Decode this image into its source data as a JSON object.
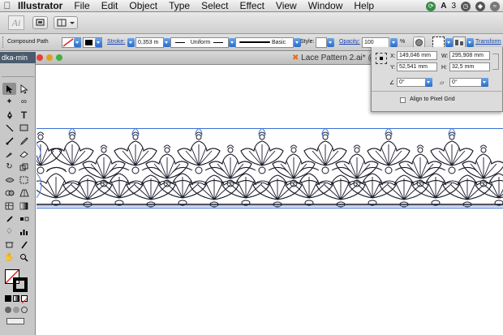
{
  "menubar": {
    "app_name": "Illustrator",
    "items": [
      "File",
      "Edit",
      "Object",
      "Type",
      "Select",
      "Effect",
      "View",
      "Window",
      "Help"
    ],
    "status_number": "3"
  },
  "appbar": {
    "logo_text": "Ai"
  },
  "control_bar": {
    "object_type": "Compound Path",
    "stroke_label": "Stroke:",
    "stroke_weight": "0,353 m",
    "profile": "Uniform",
    "brush": "Basic",
    "style_label": "Style:",
    "opacity_label": "Opacity:",
    "opacity_value": "100",
    "percent": "%",
    "transform_label": "Transform"
  },
  "left_panel": {
    "title": "dka-min"
  },
  "document": {
    "tab_title": "Lace Pattern 2.ai* @"
  },
  "transform_panel": {
    "x_label": "X:",
    "x_value": "149,046 mm",
    "y_label": "Y:",
    "y_value": "52,541 mm",
    "w_label": "W:",
    "w_value": "295,908 mm",
    "h_label": "H:",
    "h_value": "32,5 mm",
    "rotate_value": "0°",
    "shear_value": "0°",
    "pixel_grid_label": "Align to Pixel Grid"
  },
  "colors": {
    "selection": "#3b6fd4",
    "artwork": "#1a1a2a",
    "accent": "#2a6cc9",
    "panel_title": "#4b5a6d"
  },
  "icons": [
    "apple-icon",
    "selection-tool-icon",
    "direct-selection-icon",
    "pen-icon",
    "type-icon",
    "line-icon",
    "rectangle-icon",
    "brush-icon",
    "pencil-icon",
    "eraser-icon",
    "rotate-icon",
    "scale-icon",
    "eyedropper-icon",
    "hand-icon",
    "zoom-icon"
  ]
}
